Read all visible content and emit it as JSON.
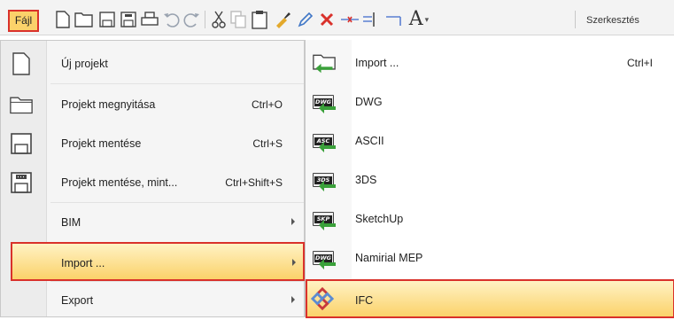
{
  "toolbar": {
    "file_label": "Fájl",
    "edit_label": "Szerkesztés",
    "icons": [
      "new-icon",
      "open-icon",
      "save-icon",
      "save-as-icon",
      "print-icon",
      "undo-icon",
      "redo-icon",
      "cut-icon",
      "copy-icon",
      "paste-icon",
      "brush-icon",
      "pencil-icon",
      "delete-icon",
      "dimension-icon",
      "align-icon",
      "ruler-icon",
      "text-icon"
    ]
  },
  "file_menu": {
    "items": [
      {
        "label": "Új projekt",
        "shortcut": "",
        "icon": "new-file-icon"
      },
      {
        "label": "Projekt megnyitása",
        "shortcut": "Ctrl+O",
        "icon": "folder-icon"
      },
      {
        "label": "Projekt mentése",
        "shortcut": "Ctrl+S",
        "icon": "save-icon"
      },
      {
        "label": "Projekt mentése, mint...",
        "shortcut": "Ctrl+Shift+S",
        "icon": "save-as-icon"
      },
      {
        "label": "BIM",
        "shortcut": "",
        "icon": ""
      },
      {
        "label": "Import ...",
        "shortcut": "",
        "icon": ""
      },
      {
        "label": "Export",
        "shortcut": "",
        "icon": ""
      }
    ]
  },
  "import_menu": {
    "items": [
      {
        "label": "Import ...",
        "shortcut": "Ctrl+I",
        "tag": ""
      },
      {
        "label": "DWG",
        "shortcut": "",
        "tag": "DWG"
      },
      {
        "label": "ASCII",
        "shortcut": "",
        "tag": "ASC"
      },
      {
        "label": "3DS",
        "shortcut": "",
        "tag": "3DS"
      },
      {
        "label": "SketchUp",
        "shortcut": "",
        "tag": "SKP"
      },
      {
        "label": "Namirial MEP",
        "shortcut": "",
        "tag": "DWG"
      },
      {
        "label": "IFC",
        "shortcut": "",
        "tag": ""
      }
    ]
  },
  "colors": {
    "highlight": "#fbd26a",
    "highlight_border": "#d9312b",
    "arrow_green": "#3aa13a"
  }
}
